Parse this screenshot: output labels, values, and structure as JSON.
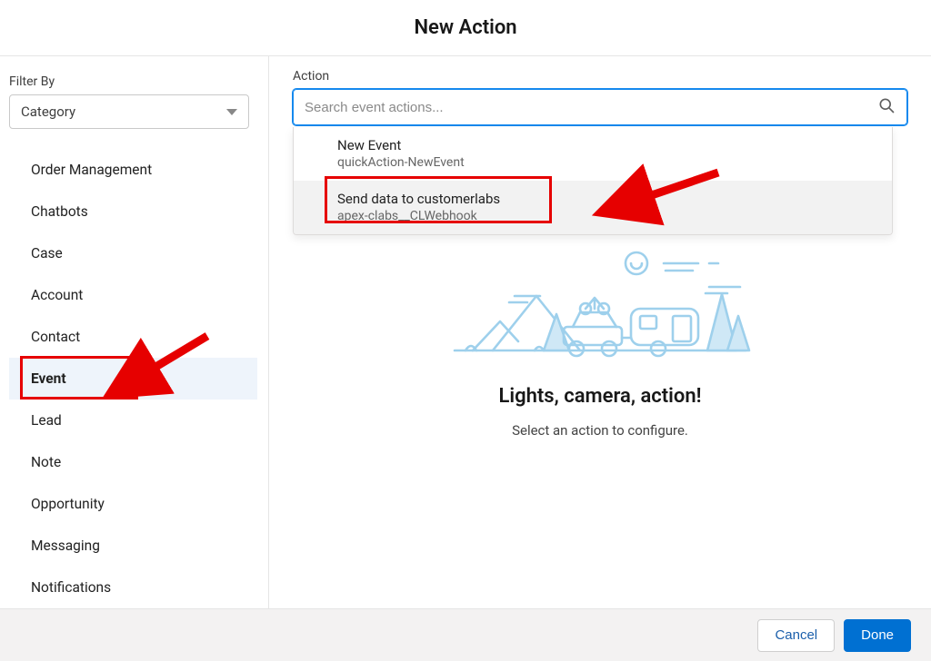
{
  "header": {
    "title": "New Action"
  },
  "sidebar": {
    "filter_label": "Filter By",
    "category_label": "Category",
    "items": [
      {
        "id": "order-management",
        "label": "Order Management"
      },
      {
        "id": "chatbots",
        "label": "Chatbots"
      },
      {
        "id": "case",
        "label": "Case"
      },
      {
        "id": "account",
        "label": "Account"
      },
      {
        "id": "contact",
        "label": "Contact"
      },
      {
        "id": "event",
        "label": "Event",
        "selected": true
      },
      {
        "id": "lead",
        "label": "Lead"
      },
      {
        "id": "note",
        "label": "Note"
      },
      {
        "id": "opportunity",
        "label": "Opportunity"
      },
      {
        "id": "messaging",
        "label": "Messaging"
      },
      {
        "id": "notifications",
        "label": "Notifications"
      }
    ]
  },
  "main": {
    "action_label": "Action",
    "search_placeholder": "Search event actions...",
    "options": [
      {
        "title": "New Event",
        "sub": "quickAction-NewEvent"
      },
      {
        "title": "Send data to customerlabs",
        "sub": "apex-clabs__CLWebhook",
        "highlighted": true
      }
    ],
    "empty_title": "Lights, camera, action!",
    "empty_sub": "Select an action to configure."
  },
  "footer": {
    "cancel_label": "Cancel",
    "done_label": "Done"
  },
  "annotations": {
    "highlight_color": "#e60000"
  }
}
